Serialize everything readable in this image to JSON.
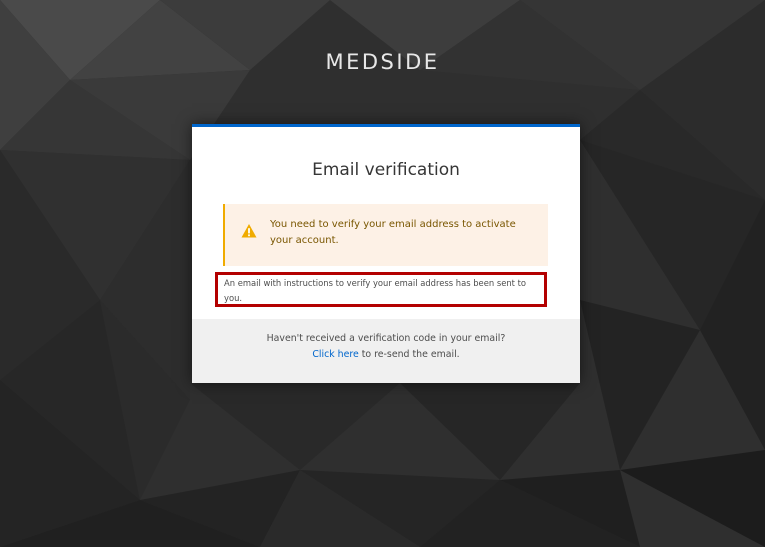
{
  "brand": {
    "title": "MEDSIDE"
  },
  "card": {
    "title": "Email verification",
    "alert": {
      "icon": "warning-triangle-icon",
      "message": "You need to verify your email address to activate your account."
    },
    "instruction": "An email with instructions to verify your email address has been sent to you.",
    "footer": {
      "question": "Haven't received a verification code in your email?",
      "link_label": "Click here",
      "suffix": " to re-send the email."
    }
  },
  "colors": {
    "accent": "#0066cc",
    "warning": "#f0ab00",
    "highlight_border": "#b30000"
  }
}
